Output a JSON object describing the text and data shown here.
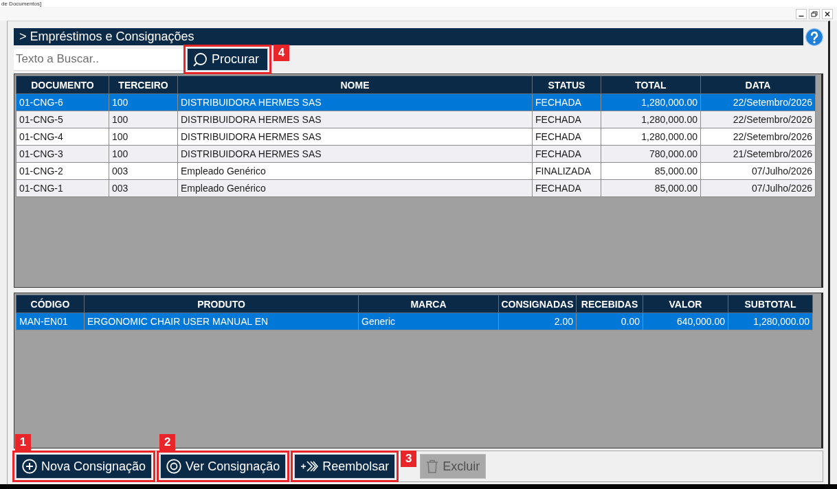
{
  "window": {
    "title": "de Documentos]"
  },
  "header": {
    "title": "> Empréstimos e Consignações"
  },
  "search": {
    "placeholder": "Texto a Buscar..",
    "button": {
      "label": "Procurar",
      "callout": {
        "label": "4",
        "kind": "beside"
      }
    }
  },
  "documents": {
    "columns": [
      "DOCUMENTO",
      "TERCEIRO",
      "NOME",
      "STATUS",
      "TOTAL",
      "DATA"
    ],
    "rows": [
      {
        "cells": [
          "01-CNG-6",
          "100",
          "DISTRIBUIDORA HERMES SAS",
          "FECHADA",
          "1,280,000.00",
          "22/Setembro/2026"
        ],
        "selected": true
      },
      {
        "cells": [
          "01-CNG-5",
          "100",
          "DISTRIBUIDORA HERMES SAS",
          "FECHADA",
          "1,280,000.00",
          "22/Setembro/2026"
        ],
        "selected": false
      },
      {
        "cells": [
          "01-CNG-4",
          "100",
          "DISTRIBUIDORA HERMES SAS",
          "FECHADA",
          "1,280,000.00",
          "22/Setembro/2026"
        ],
        "selected": false
      },
      {
        "cells": [
          "01-CNG-3",
          "100",
          "DISTRIBUIDORA HERMES SAS",
          "FECHADA",
          "780,000.00",
          "21/Setembro/2026"
        ],
        "selected": false
      },
      {
        "cells": [
          "01-CNG-2",
          "003",
          "Empleado Genérico",
          "FINALIZADA",
          "85,000.00",
          "07/Julho/2026"
        ],
        "selected": false
      },
      {
        "cells": [
          "01-CNG-1",
          "003",
          "Empleado Genérico",
          "FECHADA",
          "85,000.00",
          "07/Julho/2026"
        ],
        "selected": false
      }
    ]
  },
  "items": {
    "columns": [
      "CÓDIGO",
      "PRODUTO",
      "MARCA",
      "CONSIGNADAS",
      "RECEBIDAS",
      "VALOR",
      "SUBTOTAL"
    ],
    "rows": [
      {
        "cells": [
          "MAN-EN01",
          "ERGONOMIC CHAIR USER MANUAL EN",
          "Generic",
          "2.00",
          "0.00",
          "640,000.00",
          "1,280,000.00"
        ],
        "selected": true
      }
    ]
  },
  "actions": [
    {
      "label": "Nova Consignação",
      "kind": "add",
      "disabled": false,
      "callout": {
        "label": "1",
        "kind": "above"
      }
    },
    {
      "label": "Ver Consignação",
      "kind": "view",
      "disabled": false,
      "callout": {
        "label": "2",
        "kind": "above"
      }
    },
    {
      "label": "Reembolsar",
      "kind": "refund",
      "disabled": false,
      "callout": {
        "label": "3",
        "kind": "beside"
      }
    },
    {
      "label": "Excluir",
      "kind": "delete",
      "disabled": true
    }
  ]
}
